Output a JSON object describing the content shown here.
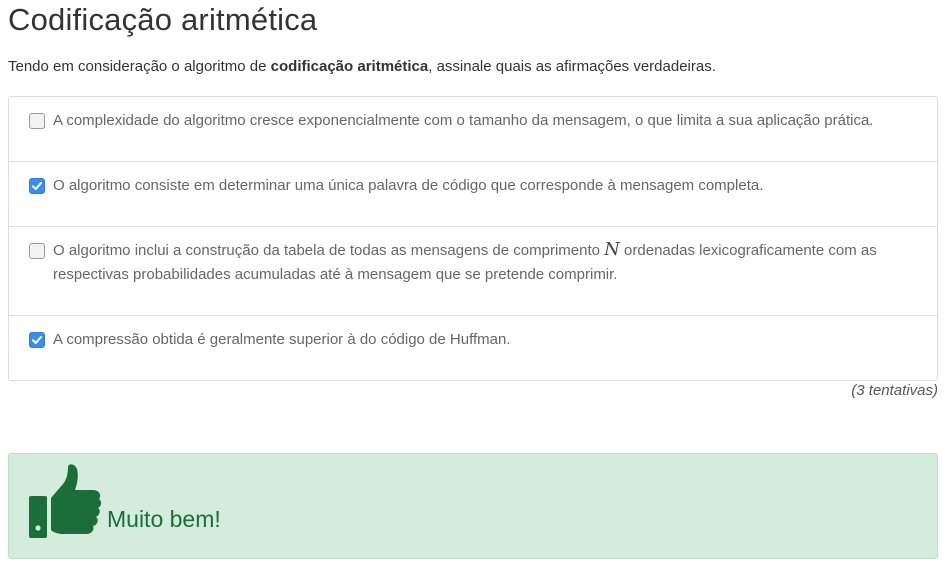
{
  "question": {
    "title": "Codificação aritmética",
    "prompt_before": "Tendo em consideração o algoritmo de ",
    "prompt_bold": "codificação aritmética",
    "prompt_after": ", assinale quais as afirmações verdadeiras."
  },
  "options": [
    {
      "text": "A complexidade do algoritmo cresce exponencialmente com o tamanho da mensagem, o que limita a sua aplicação prática.",
      "checked": false
    },
    {
      "text": "O algoritmo consiste em determinar uma única palavra de código que corresponde à mensagem completa.",
      "checked": true
    },
    {
      "text_before": "O algoritmo inclui a construção da tabela de todas as mensagens de comprimento ",
      "math": "N",
      "text_after": " ordenadas lexicograficamente com as respectivas probabilidades acumuladas até à mensagem que se pretende comprimir.",
      "checked": false
    },
    {
      "text": "A compressão obtida é geralmente superior à do código de Huffman.",
      "checked": true
    }
  ],
  "attempts": "(3 tentativas)",
  "feedback": {
    "message": "Muito bem!",
    "icon": "thumbs-up-icon",
    "color": "#1b6e3a"
  },
  "colors": {
    "checkbox_checked": "#3b8ee8",
    "success_background": "#d3ecdb"
  }
}
